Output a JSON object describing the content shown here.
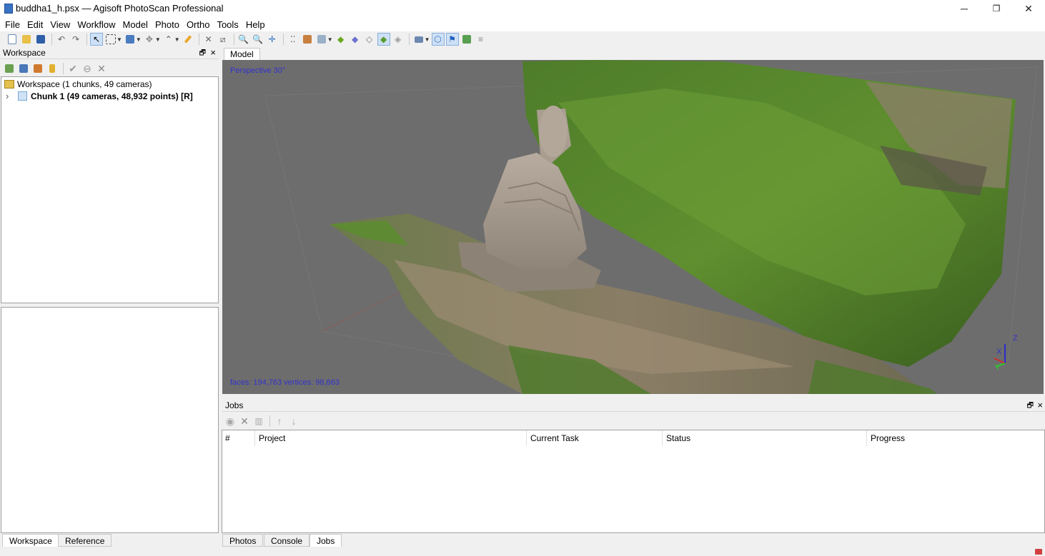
{
  "window": {
    "title": "buddha1_h.psx — Agisoft PhotoScan Professional",
    "minimize_glyph": "─",
    "restore_glyph": "❐",
    "close_glyph": "✕"
  },
  "menu": [
    "File",
    "Edit",
    "View",
    "Workflow",
    "Model",
    "Photo",
    "Ortho",
    "Tools",
    "Help"
  ],
  "workspace_panel": {
    "title": "Workspace",
    "float_glyph": "🗗",
    "close_glyph": "×",
    "tree_root": "Workspace (1 chunks, 49 cameras)",
    "chunk_label": "Chunk 1 (49 cameras, 48,932 points) [R]",
    "expand_glyph": "›"
  },
  "model_tab": {
    "label": "Model"
  },
  "viewport": {
    "projection": "Perspective 30°",
    "stats": "faces: 194,763 vertices: 98,663",
    "axis_x": "X",
    "axis_y": "Y",
    "axis_z": "Z"
  },
  "jobs_panel": {
    "title": "Jobs",
    "float_glyph": "🗗",
    "close_glyph": "×",
    "columns": [
      "#",
      "Project",
      "Current Task",
      "Status",
      "Progress"
    ]
  },
  "bottom_tabs_left": [
    {
      "label": "Workspace",
      "active": true
    },
    {
      "label": "Reference",
      "active": false
    }
  ],
  "bottom_tabs_right": [
    {
      "label": "Photos",
      "active": false
    },
    {
      "label": "Console",
      "active": false
    },
    {
      "label": "Jobs",
      "active": true
    }
  ],
  "colors": {
    "viewport_bg": "#6d6d6d",
    "overlay_text": "#3333cc",
    "accent": "#3a72c4"
  }
}
